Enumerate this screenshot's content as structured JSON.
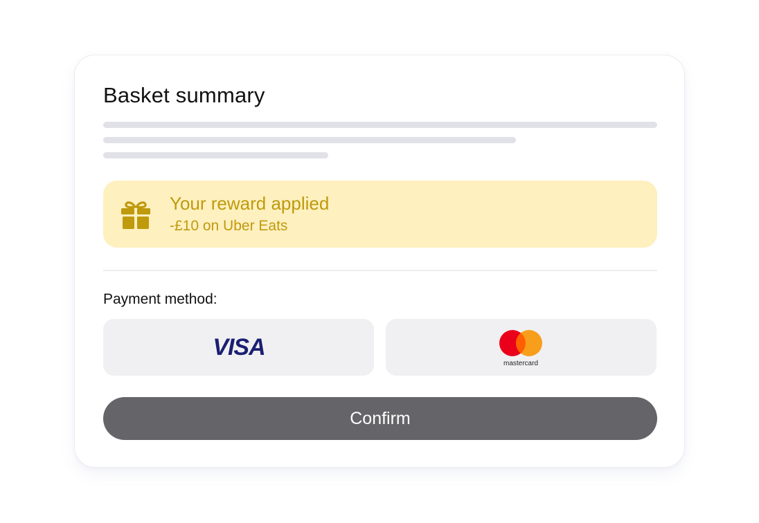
{
  "basket": {
    "title": "Basket summary"
  },
  "reward": {
    "icon": "gift-icon",
    "title": "Your reward applied",
    "subtitle": "-£10 on Uber Eats",
    "accent_color": "#bf9a0d",
    "background_color": "#fef0bf"
  },
  "payment": {
    "label": "Payment method:",
    "options": [
      {
        "name": "Visa",
        "logo_text": "VISA",
        "color": "#1a1f71"
      },
      {
        "name": "Mastercard",
        "logo_text": "mastercard",
        "colors": [
          "#eb001b",
          "#f79e1b"
        ]
      }
    ]
  },
  "confirm": {
    "label": "Confirm",
    "color": "#656468"
  }
}
